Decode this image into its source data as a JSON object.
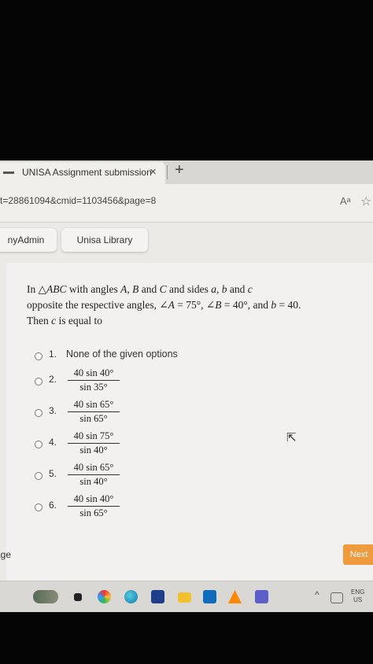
{
  "browser": {
    "tab_title": "UNISA Assignment submission",
    "tab_close": "×",
    "new_tab": "+",
    "url": "t=28861094&cmid=1103456&page=8",
    "read_aloud_icon": "Aᵃ",
    "favorite_icon": "☆"
  },
  "bookmarks": [
    "nyAdmin",
    "Unisa Library"
  ],
  "question": {
    "lines": [
      [
        "In ",
        "△ABC",
        " with angles ",
        "A",
        ", ",
        "B",
        " and ",
        "C",
        " and sides ",
        "a",
        ", ",
        "b",
        " and ",
        "c"
      ],
      [
        "opposite the respective angles, ",
        "∠A",
        " = 75°, ",
        "∠B",
        " = 40°, and ",
        "b",
        " = 40."
      ],
      [
        "Then ",
        "c",
        " is equal to"
      ]
    ]
  },
  "options": [
    {
      "number": "1.",
      "text": "None of the given options"
    },
    {
      "number": "2.",
      "numerator": "40 sin 40°",
      "denominator": "sin 35°"
    },
    {
      "number": "3.",
      "numerator": "40 sin 65°",
      "denominator": "sin 65°"
    },
    {
      "number": "4.",
      "numerator": "40 sin 75°",
      "denominator": "sin 40°"
    },
    {
      "number": "5.",
      "numerator": "40 sin 65°",
      "denominator": "sin 40°"
    },
    {
      "number": "6.",
      "numerator": "40 sin 40°",
      "denominator": "sin 65°"
    }
  ],
  "navigation": {
    "previous_label": "age",
    "next_label": "Next"
  },
  "taskbar": {
    "icons": [
      "copilot-icon",
      "widgets-icon",
      "multicolor-app-icon",
      "edge-icon",
      "store-icon",
      "file-explorer-icon",
      "outlook-icon",
      "vlc-icon",
      "teams-icon"
    ],
    "tray_arrow": "^",
    "lang_line1": "ENG",
    "lang_line2": "US"
  },
  "colors": {
    "next_button": "#ef9a3c"
  }
}
